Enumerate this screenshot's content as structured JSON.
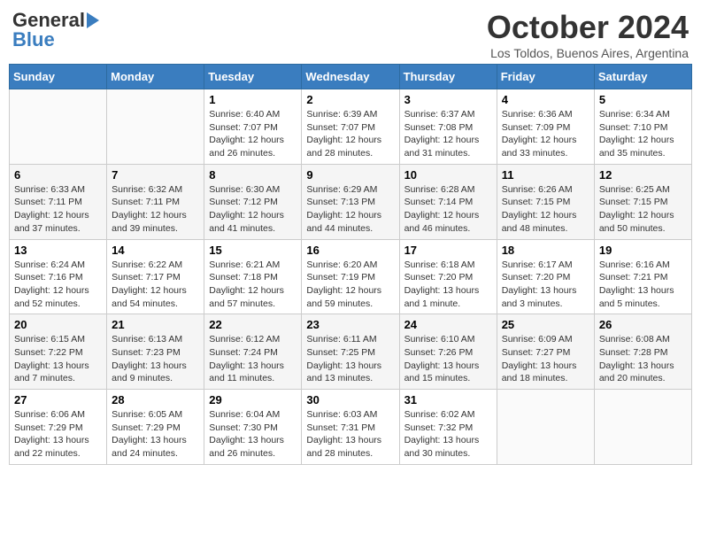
{
  "header": {
    "logo_general": "General",
    "logo_blue": "Blue",
    "month_title": "October 2024",
    "subtitle": "Los Toldos, Buenos Aires, Argentina"
  },
  "weekdays": [
    "Sunday",
    "Monday",
    "Tuesday",
    "Wednesday",
    "Thursday",
    "Friday",
    "Saturday"
  ],
  "weeks": [
    [
      {
        "day": "",
        "info": ""
      },
      {
        "day": "",
        "info": ""
      },
      {
        "day": "1",
        "info": "Sunrise: 6:40 AM\nSunset: 7:07 PM\nDaylight: 12 hours and 26 minutes."
      },
      {
        "day": "2",
        "info": "Sunrise: 6:39 AM\nSunset: 7:07 PM\nDaylight: 12 hours and 28 minutes."
      },
      {
        "day": "3",
        "info": "Sunrise: 6:37 AM\nSunset: 7:08 PM\nDaylight: 12 hours and 31 minutes."
      },
      {
        "day": "4",
        "info": "Sunrise: 6:36 AM\nSunset: 7:09 PM\nDaylight: 12 hours and 33 minutes."
      },
      {
        "day": "5",
        "info": "Sunrise: 6:34 AM\nSunset: 7:10 PM\nDaylight: 12 hours and 35 minutes."
      }
    ],
    [
      {
        "day": "6",
        "info": "Sunrise: 6:33 AM\nSunset: 7:11 PM\nDaylight: 12 hours and 37 minutes."
      },
      {
        "day": "7",
        "info": "Sunrise: 6:32 AM\nSunset: 7:11 PM\nDaylight: 12 hours and 39 minutes."
      },
      {
        "day": "8",
        "info": "Sunrise: 6:30 AM\nSunset: 7:12 PM\nDaylight: 12 hours and 41 minutes."
      },
      {
        "day": "9",
        "info": "Sunrise: 6:29 AM\nSunset: 7:13 PM\nDaylight: 12 hours and 44 minutes."
      },
      {
        "day": "10",
        "info": "Sunrise: 6:28 AM\nSunset: 7:14 PM\nDaylight: 12 hours and 46 minutes."
      },
      {
        "day": "11",
        "info": "Sunrise: 6:26 AM\nSunset: 7:15 PM\nDaylight: 12 hours and 48 minutes."
      },
      {
        "day": "12",
        "info": "Sunrise: 6:25 AM\nSunset: 7:15 PM\nDaylight: 12 hours and 50 minutes."
      }
    ],
    [
      {
        "day": "13",
        "info": "Sunrise: 6:24 AM\nSunset: 7:16 PM\nDaylight: 12 hours and 52 minutes."
      },
      {
        "day": "14",
        "info": "Sunrise: 6:22 AM\nSunset: 7:17 PM\nDaylight: 12 hours and 54 minutes."
      },
      {
        "day": "15",
        "info": "Sunrise: 6:21 AM\nSunset: 7:18 PM\nDaylight: 12 hours and 57 minutes."
      },
      {
        "day": "16",
        "info": "Sunrise: 6:20 AM\nSunset: 7:19 PM\nDaylight: 12 hours and 59 minutes."
      },
      {
        "day": "17",
        "info": "Sunrise: 6:18 AM\nSunset: 7:20 PM\nDaylight: 13 hours and 1 minute."
      },
      {
        "day": "18",
        "info": "Sunrise: 6:17 AM\nSunset: 7:20 PM\nDaylight: 13 hours and 3 minutes."
      },
      {
        "day": "19",
        "info": "Sunrise: 6:16 AM\nSunset: 7:21 PM\nDaylight: 13 hours and 5 minutes."
      }
    ],
    [
      {
        "day": "20",
        "info": "Sunrise: 6:15 AM\nSunset: 7:22 PM\nDaylight: 13 hours and 7 minutes."
      },
      {
        "day": "21",
        "info": "Sunrise: 6:13 AM\nSunset: 7:23 PM\nDaylight: 13 hours and 9 minutes."
      },
      {
        "day": "22",
        "info": "Sunrise: 6:12 AM\nSunset: 7:24 PM\nDaylight: 13 hours and 11 minutes."
      },
      {
        "day": "23",
        "info": "Sunrise: 6:11 AM\nSunset: 7:25 PM\nDaylight: 13 hours and 13 minutes."
      },
      {
        "day": "24",
        "info": "Sunrise: 6:10 AM\nSunset: 7:26 PM\nDaylight: 13 hours and 15 minutes."
      },
      {
        "day": "25",
        "info": "Sunrise: 6:09 AM\nSunset: 7:27 PM\nDaylight: 13 hours and 18 minutes."
      },
      {
        "day": "26",
        "info": "Sunrise: 6:08 AM\nSunset: 7:28 PM\nDaylight: 13 hours and 20 minutes."
      }
    ],
    [
      {
        "day": "27",
        "info": "Sunrise: 6:06 AM\nSunset: 7:29 PM\nDaylight: 13 hours and 22 minutes."
      },
      {
        "day": "28",
        "info": "Sunrise: 6:05 AM\nSunset: 7:29 PM\nDaylight: 13 hours and 24 minutes."
      },
      {
        "day": "29",
        "info": "Sunrise: 6:04 AM\nSunset: 7:30 PM\nDaylight: 13 hours and 26 minutes."
      },
      {
        "day": "30",
        "info": "Sunrise: 6:03 AM\nSunset: 7:31 PM\nDaylight: 13 hours and 28 minutes."
      },
      {
        "day": "31",
        "info": "Sunrise: 6:02 AM\nSunset: 7:32 PM\nDaylight: 13 hours and 30 minutes."
      },
      {
        "day": "",
        "info": ""
      },
      {
        "day": "",
        "info": ""
      }
    ]
  ]
}
